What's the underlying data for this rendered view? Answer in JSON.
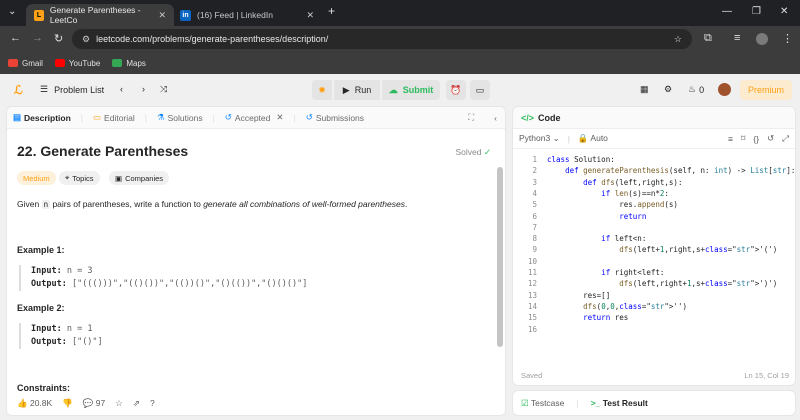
{
  "browser": {
    "tabs": [
      {
        "title": "Generate Parentheses - LeetCo",
        "favicon": "leetcode-icon",
        "active": true
      },
      {
        "title": "(16) Feed | LinkedIn",
        "favicon": "linkedin-icon",
        "active": false
      }
    ],
    "new_tab": "+",
    "url": "leetcode.com/problems/generate-parentheses/description/",
    "bookmarks": [
      {
        "label": "Gmail",
        "icon": "gmail-icon",
        "color": "#ea4335"
      },
      {
        "label": "YouTube",
        "icon": "youtube-icon",
        "color": "#ff0000"
      },
      {
        "label": "Maps",
        "icon": "maps-icon",
        "color": "#34a853"
      }
    ]
  },
  "nav": {
    "problem_list": "Problem List",
    "run": "Run",
    "submit": "Submit",
    "streak": "0",
    "premium": "Premium",
    "colors": {
      "submit": "#2cbb5d",
      "premium": "#ffa116"
    }
  },
  "left": {
    "tabs": [
      "Description",
      "Editorial",
      "Solutions",
      "Accepted",
      "Submissions"
    ],
    "title": "22. Generate Parentheses",
    "solved": "Solved",
    "tags": [
      "Medium",
      "Topics",
      "Companies"
    ],
    "desc_pre": "Given ",
    "desc_n": "n",
    "desc_mid": " pairs of parentheses, write a function to ",
    "desc_em": "generate all combinations of well-formed parentheses",
    "desc_end": ".",
    "example1_title": "Example 1:",
    "example1_input_label": "Input:",
    "example1_input": "n = 3",
    "example1_output_label": "Output:",
    "example1_output": "[\"((()))\",\"(()())\",\"(())()\",\"()(())\",\"()()()\"]",
    "example2_title": "Example 2:",
    "example2_input_label": "Input:",
    "example2_input": "n = 1",
    "example2_output_label": "Output:",
    "example2_output": "[\"()\"]",
    "constraints_title": "Constraints:",
    "likes": "20.8K",
    "comments": "97"
  },
  "right": {
    "header": "Code",
    "language": "Python3",
    "auto": "Auto",
    "code_lines": [
      "class Solution:",
      "    def generateParenthesis(self, n: int) -> List[str]:",
      "        def dfs(left,right,s):",
      "            if len(s)==n*2:",
      "                res.append(s)",
      "                return",
      "",
      "            if left<n:",
      "                dfs(left+1,right,s+'(')",
      "",
      "            if right<left:",
      "                dfs(left,right+1,s+')')",
      "        res=[]",
      "        dfs(0,0,'')",
      "        return res",
      ""
    ],
    "saved": "Saved",
    "cursor": "Ln 15, Col 19",
    "testcase": "Testcase",
    "test_result": "Test Result"
  }
}
